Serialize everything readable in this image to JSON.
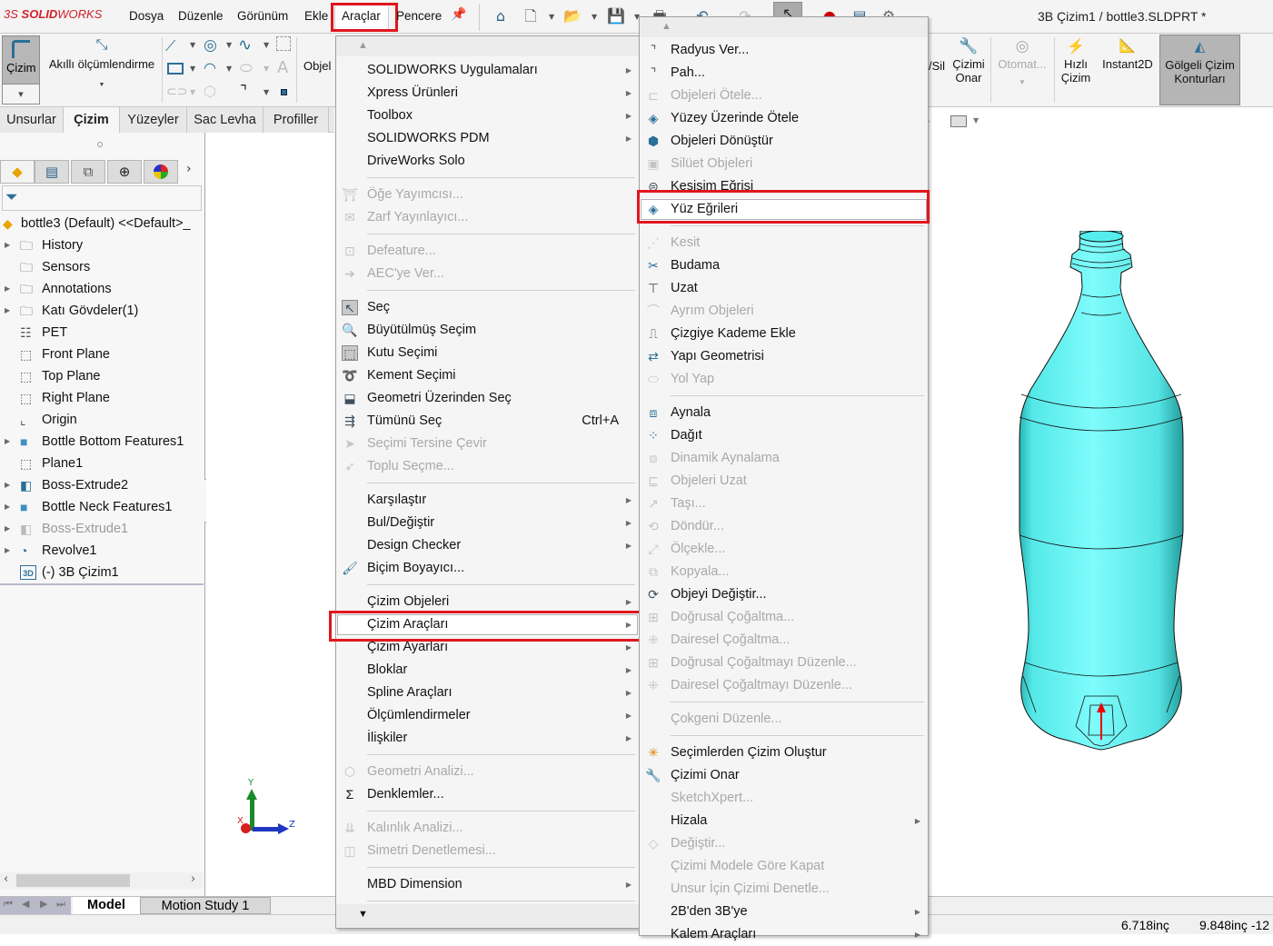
{
  "app": {
    "logo_prefix": "3S",
    "logo_bold": "SOLID",
    "logo_rest": "WORKS",
    "document_title": "3B Çizim1 / bottle3.SLDPRT *"
  },
  "menubar": [
    "Dosya",
    "Düzenle",
    "Görünüm",
    "Ekle",
    "Araçlar",
    "Pencere"
  ],
  "ribbon": {
    "cizim": "Çizim",
    "akilli": "Akıllı ölçümlendirme",
    "objeler_partial": "Objel",
    "sil_partial": "/Sil",
    "cizimi_onar": [
      "Çizimi",
      "Onar"
    ],
    "otomat": "Otomat...",
    "hizli": [
      "Hızlı",
      "Çizim"
    ],
    "instant2d": "Instant2D",
    "golgeli": [
      "Gölgeli Çizim",
      "Konturları"
    ]
  },
  "tabs": [
    "Unsurlar",
    "Çizim",
    "Yüzeyler",
    "Sac Levha",
    "Profiller"
  ],
  "active_tab": "Çizim",
  "tree": {
    "root": "bottle3 (Default) <<Default>_",
    "items": [
      {
        "label": "History",
        "expand": true,
        "icon": "history-folder-icon",
        "dim": false
      },
      {
        "label": "Sensors",
        "expand": false,
        "icon": "sensors-folder-icon",
        "dim": false
      },
      {
        "label": "Annotations",
        "expand": true,
        "icon": "annotations-folder-icon",
        "dim": false
      },
      {
        "label": "Katı Gövdeler(1)",
        "expand": true,
        "icon": "solid-bodies-folder-icon",
        "dim": false
      },
      {
        "label": "PET",
        "expand": false,
        "icon": "material-icon",
        "dim": false
      },
      {
        "label": "Front Plane",
        "expand": false,
        "icon": "plane-icon",
        "dim": false
      },
      {
        "label": "Top Plane",
        "expand": false,
        "icon": "plane-icon",
        "dim": false
      },
      {
        "label": "Right Plane",
        "expand": false,
        "icon": "plane-icon",
        "dim": false
      },
      {
        "label": "Origin",
        "expand": false,
        "icon": "origin-icon",
        "dim": false
      },
      {
        "label": "Bottle Bottom Features1",
        "expand": true,
        "icon": "folder-icon",
        "dim": false
      },
      {
        "label": "Plane1",
        "expand": false,
        "icon": "plane-icon",
        "dim": false
      },
      {
        "label": "Boss-Extrude2",
        "expand": true,
        "icon": "extrude-icon",
        "dim": false
      },
      {
        "label": "Bottle Neck Features1",
        "expand": true,
        "icon": "folder-icon",
        "dim": false
      },
      {
        "label": "Boss-Extrude1",
        "expand": true,
        "icon": "extrude-icon",
        "dim": true
      },
      {
        "label": "Revolve1",
        "expand": true,
        "icon": "revolve-icon",
        "dim": false
      },
      {
        "label": "(-) 3B Çizim1",
        "expand": false,
        "icon": "3d-sketch-icon",
        "dim": false
      }
    ]
  },
  "tools_menu": {
    "items": [
      {
        "label": "SOLIDWORKS Uygulamaları",
        "sub": true
      },
      {
        "label": "Xpress Ürünleri",
        "sub": true
      },
      {
        "label": "Toolbox",
        "sub": true
      },
      {
        "label": "SOLIDWORKS PDM",
        "sub": true
      },
      {
        "label": "DriveWorks Solo"
      },
      {
        "sep": true
      },
      {
        "label": "Öğe Yayımcısı...",
        "dis": true,
        "icon": "item-publisher-icon"
      },
      {
        "label": "Zarf Yayınlayıcı...",
        "dis": true,
        "icon": "envelope-publisher-icon"
      },
      {
        "sep": true
      },
      {
        "label": "Defeature...",
        "dis": true,
        "icon": "defeature-icon"
      },
      {
        "label": "AEC'ye Ver...",
        "dis": true,
        "icon": "aec-export-icon"
      },
      {
        "sep": true
      },
      {
        "label": "Seç",
        "icon": "select-arrow-icon"
      },
      {
        "label": "Büyütülmüş Seçim",
        "icon": "magnified-selection-icon"
      },
      {
        "label": "Kutu Seçimi",
        "icon": "box-selection-icon"
      },
      {
        "label": "Kement Seçimi",
        "icon": "lasso-selection-icon"
      },
      {
        "label": "Geometri Üzerinden Seç",
        "icon": "select-over-geometry-icon"
      },
      {
        "label": "Tümünü Seç",
        "shortcut": "Ctrl+A",
        "icon": "select-all-icon"
      },
      {
        "label": "Seçimi Tersine Çevir",
        "dis": true,
        "icon": "invert-selection-icon"
      },
      {
        "label": "Toplu Seçme...",
        "dis": true,
        "icon": "bulk-selection-icon"
      },
      {
        "sep": true
      },
      {
        "label": "Karşılaştır",
        "sub": true
      },
      {
        "label": "Bul/Değiştir",
        "sub": true
      },
      {
        "label": "Design Checker",
        "sub": true
      },
      {
        "label": "Biçim Boyayıcı...",
        "icon": "format-painter-icon"
      },
      {
        "sep": true
      },
      {
        "label": "Çizim Objeleri",
        "sub": true
      },
      {
        "label": "Çizim Araçları",
        "sub": true,
        "hl": true
      },
      {
        "label": "Çizim Ayarları",
        "sub": true
      },
      {
        "label": "Bloklar",
        "sub": true
      },
      {
        "label": "Spline Araçları",
        "sub": true
      },
      {
        "label": "Ölçümlendirmeler",
        "sub": true
      },
      {
        "label": "İlişkiler",
        "sub": true
      },
      {
        "sep": true
      },
      {
        "label": "Geometri Analizi...",
        "dis": true,
        "icon": "geometry-analysis-icon"
      },
      {
        "label": "Denklemler...",
        "icon": "sigma-icon"
      },
      {
        "sep": true
      },
      {
        "label": "Kalınlık Analizi...",
        "dis": true,
        "icon": "thickness-analysis-icon"
      },
      {
        "label": "Simetri Denetlemesi...",
        "dis": true,
        "icon": "symmetry-check-icon"
      },
      {
        "sep": true
      },
      {
        "label": "MBD Dimension",
        "sub": true
      },
      {
        "sep": true
      }
    ]
  },
  "sketch_tools_menu": {
    "items": [
      {
        "label": "Radyus Ver...",
        "icon": "fillet-icon"
      },
      {
        "label": "Pah...",
        "icon": "chamfer-icon"
      },
      {
        "label": "Objeleri Ötele...",
        "dis": true,
        "icon": "offset-entities-icon"
      },
      {
        "label": "Yüzey Üzerinde Ötele",
        "icon": "offset-on-surface-icon"
      },
      {
        "label": "Objeleri Dönüştür",
        "icon": "convert-entities-icon"
      },
      {
        "label": "Silüet Objeleri",
        "dis": true,
        "icon": "silhouette-entities-icon"
      },
      {
        "label": "Kesişim Eğrisi",
        "icon": "intersection-curve-icon"
      },
      {
        "label": "Yüz Eğrileri",
        "icon": "face-curves-icon",
        "hl": true
      },
      {
        "sep": true
      },
      {
        "label": "Kesit",
        "dis": true,
        "icon": "segment-icon"
      },
      {
        "label": "Budama",
        "icon": "trim-icon"
      },
      {
        "label": "Uzat",
        "icon": "extend-icon"
      },
      {
        "label": "Ayrım Objeleri",
        "dis": true,
        "icon": "split-entities-icon"
      },
      {
        "label": "Çizgiye Kademe Ekle",
        "icon": "jog-line-icon"
      },
      {
        "label": "Yapı Geometrisi",
        "icon": "construction-geometry-icon"
      },
      {
        "label": "Yol Yap",
        "dis": true,
        "icon": "make-path-icon"
      },
      {
        "sep": true
      },
      {
        "label": "Aynala",
        "icon": "mirror-icon"
      },
      {
        "label": "Dağıt",
        "icon": "explode-icon"
      },
      {
        "label": "Dinamik Aynalama",
        "dis": true,
        "icon": "dynamic-mirror-icon"
      },
      {
        "label": "Objeleri Uzat",
        "dis": true,
        "icon": "stretch-entities-icon"
      },
      {
        "label": "Taşı...",
        "dis": true,
        "icon": "move-icon"
      },
      {
        "label": "Döndür...",
        "dis": true,
        "icon": "rotate-icon"
      },
      {
        "label": "Ölçekle...",
        "dis": true,
        "icon": "scale-icon"
      },
      {
        "label": "Kopyala...",
        "dis": true,
        "icon": "copy-icon"
      },
      {
        "label": "Objeyi Değiştir...",
        "icon": "replace-entity-icon"
      },
      {
        "label": "Doğrusal Çoğaltma...",
        "dis": true,
        "icon": "linear-pattern-icon"
      },
      {
        "label": "Dairesel Çoğaltma...",
        "dis": true,
        "icon": "circular-pattern-icon"
      },
      {
        "label": "Doğrusal Çoğaltmayı Düzenle...",
        "dis": true,
        "icon": "edit-linear-pattern-icon"
      },
      {
        "label": "Dairesel Çoğaltmayı Düzenle...",
        "dis": true,
        "icon": "edit-circular-pattern-icon"
      },
      {
        "sep": true
      },
      {
        "label": "Çokgeni Düzenle...",
        "dis": true
      },
      {
        "sep": true
      },
      {
        "label": "Seçimlerden Çizim Oluştur",
        "icon": "sketch-from-selections-icon"
      },
      {
        "label": "Çizimi Onar",
        "icon": "repair-sketch-icon"
      },
      {
        "label": "SketchXpert...",
        "dis": true
      },
      {
        "label": "Hizala",
        "sub": true
      },
      {
        "label": "Değiştir...",
        "dis": true,
        "icon": "modify-icon"
      },
      {
        "label": "Çizimi Modele Göre Kapat",
        "dis": true
      },
      {
        "label": "Unsur İçin Çizimi Denetle...",
        "dis": true
      },
      {
        "label": "2B'den 3B'ye",
        "sub": true
      },
      {
        "label": "Kalem Araçları",
        "sub": true
      }
    ]
  },
  "triad": {
    "x": "X",
    "y": "Y",
    "z": "Z"
  },
  "bottom_tabs": [
    "Model",
    "Motion Study 1"
  ],
  "status": {
    "x": "6.718inç",
    "y": "9.848inç -12"
  },
  "colors": {
    "highlight": "#e0161e",
    "bottle": "#66f5f5",
    "accent": "#2a6f97"
  }
}
